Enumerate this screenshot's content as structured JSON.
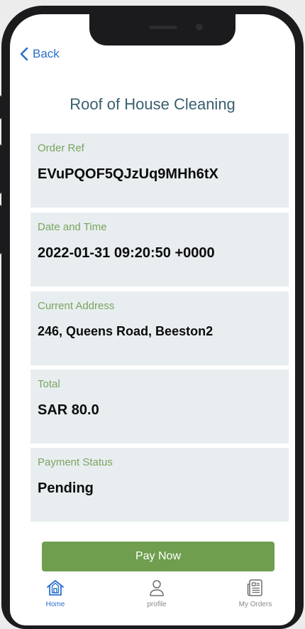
{
  "nav": {
    "back_label": "Back"
  },
  "page": {
    "title": "Roof of House Cleaning"
  },
  "details": [
    {
      "label": "Order Ref",
      "value": "EVuPQOF5QJzUq9MHh6tX"
    },
    {
      "label": "Date and Time",
      "value": "2022-01-31 09:20:50 +0000"
    },
    {
      "label": "Current Address",
      "value": "246, Queens Road, Beeston2"
    },
    {
      "label": "Total",
      "value": "SAR 80.0"
    },
    {
      "label": "Payment Status",
      "value": "Pending"
    }
  ],
  "actions": {
    "pay_label": "Pay Now"
  },
  "tabs": [
    {
      "label": "Home",
      "icon": "home-icon",
      "active": true
    },
    {
      "label": "profile",
      "icon": "person-icon",
      "active": false
    },
    {
      "label": "My Orders",
      "icon": "orders-icon",
      "active": false
    }
  ],
  "colors": {
    "accent": "#2a6fcb",
    "button": "#6f9e4f",
    "label": "#7aa35f",
    "card": "#e8eef0",
    "title": "#3a5f6e"
  }
}
